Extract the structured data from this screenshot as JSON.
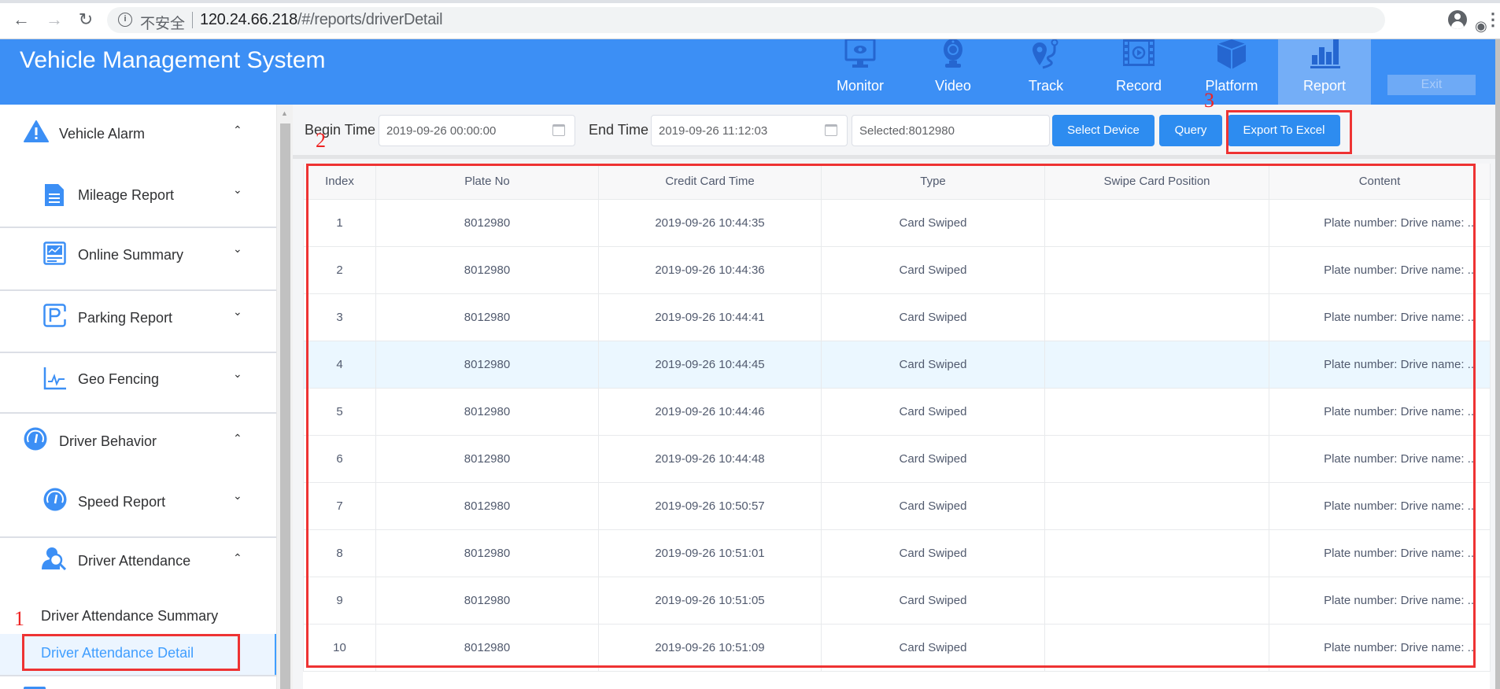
{
  "browser": {
    "insecure_label": "不安全",
    "url_host": "120.24.66.218",
    "url_path": "/#/reports/driverDetail"
  },
  "header": {
    "title": "Vehicle Management System",
    "nav": [
      {
        "label": "Monitor",
        "icon": "monitor-icon"
      },
      {
        "label": "Video",
        "icon": "webcam-icon"
      },
      {
        "label": "Track",
        "icon": "route-pin-icon"
      },
      {
        "label": "Record",
        "icon": "film-record-icon"
      },
      {
        "label": "Platform",
        "icon": "cube-icon"
      },
      {
        "label": "Report",
        "icon": "bar-chart-icon",
        "active": true
      }
    ],
    "exit_label": "Exit"
  },
  "sidebar": {
    "items": [
      {
        "label": "Vehicle Alarm",
        "icon": "warning-icon",
        "expanded": true
      },
      {
        "label": "Mileage Report",
        "icon": "document-icon",
        "expanded": false
      },
      {
        "label": "Online Summary",
        "icon": "dashboard-chart-icon",
        "expanded": false
      },
      {
        "label": "Parking Report",
        "icon": "parking-icon",
        "expanded": false
      },
      {
        "label": "Geo Fencing",
        "icon": "pulse-chart-icon",
        "expanded": false
      },
      {
        "label": "Driver Behavior",
        "icon": "gauge-icon",
        "expanded": true
      },
      {
        "label": "Speed Report",
        "icon": "gauge-icon",
        "expanded": false
      },
      {
        "label": "Driver Attendance",
        "icon": "user-search-icon",
        "expanded": true
      }
    ],
    "sub_items": [
      {
        "label": "Driver Attendance Summary"
      },
      {
        "label": "Driver Attendance Detail",
        "active": true
      }
    ]
  },
  "annotations": [
    "1",
    "2",
    "3"
  ],
  "filters": {
    "begin_label": "Begin Time",
    "begin_value": "2019-09-26 00:00:00",
    "end_label": "End Time",
    "end_value": "2019-09-26 11:12:03",
    "selected_value": "Selected:8012980",
    "select_device_label": "Select Device",
    "query_label": "Query",
    "export_label": "Export To Excel"
  },
  "table": {
    "columns": [
      "Index",
      "Plate No",
      "Credit Card Time",
      "Type",
      "Swipe Card Position",
      "Content"
    ],
    "rows": [
      [
        "1",
        "8012980",
        "2019-09-26 10:44:35",
        "Card Swiped",
        "",
        "Plate number: Drive name:  .."
      ],
      [
        "2",
        "8012980",
        "2019-09-26 10:44:36",
        "Card Swiped",
        "",
        "Plate number: Drive name:  .."
      ],
      [
        "3",
        "8012980",
        "2019-09-26 10:44:41",
        "Card Swiped",
        "",
        "Plate number: Drive name:  .."
      ],
      [
        "4",
        "8012980",
        "2019-09-26 10:44:45",
        "Card Swiped",
        "",
        "Plate number: Drive name:  .."
      ],
      [
        "5",
        "8012980",
        "2019-09-26 10:44:46",
        "Card Swiped",
        "",
        "Plate number: Drive name:  .."
      ],
      [
        "6",
        "8012980",
        "2019-09-26 10:44:48",
        "Card Swiped",
        "",
        "Plate number: Drive name:  .."
      ],
      [
        "7",
        "8012980",
        "2019-09-26 10:50:57",
        "Card Swiped",
        "",
        "Plate number: Drive name:  .."
      ],
      [
        "8",
        "8012980",
        "2019-09-26 10:51:01",
        "Card Swiped",
        "",
        "Plate number: Drive name:  .."
      ],
      [
        "9",
        "8012980",
        "2019-09-26 10:51:05",
        "Card Swiped",
        "",
        "Plate number: Drive name:  .."
      ],
      [
        "10",
        "8012980",
        "2019-09-26 10:51:09",
        "Card Swiped",
        "",
        "Plate number: Drive name:  .."
      ]
    ],
    "highlighted_row": 4
  },
  "colors": {
    "header_blue": "#3c8ff5",
    "active_nav": "#74aef7",
    "button_blue": "#2d8cf0",
    "link_active": "#409eff",
    "annotation_red": "#ee3333",
    "row_highlight": "#ebf7ff"
  }
}
